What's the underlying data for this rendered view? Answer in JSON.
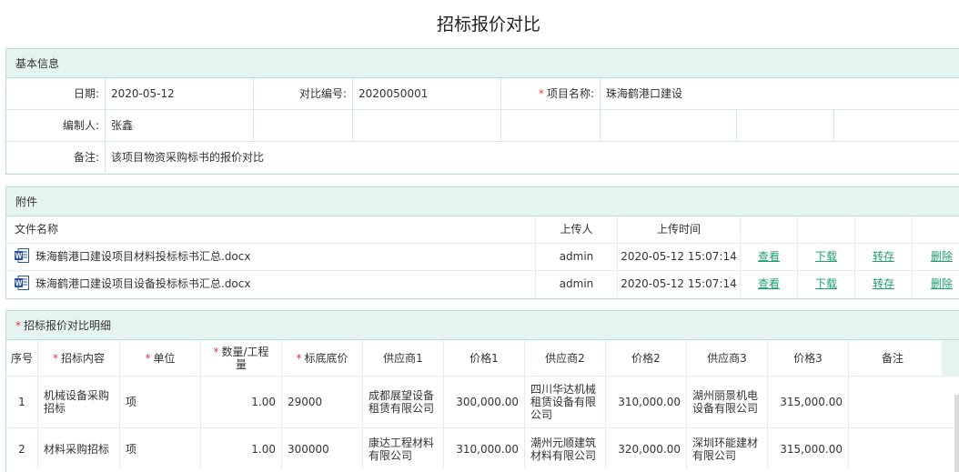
{
  "page": {
    "title": "招标报价对比"
  },
  "basic": {
    "header": "基本信息",
    "date_label": "日期:",
    "date_value": "2020-05-12",
    "no_label": "对比编号:",
    "no_value": "2020050001",
    "project_label": "项目名称:",
    "project_value": "珠海鹤港口建设",
    "editor_label": "编制人:",
    "editor_value": "张鑫",
    "remark_label": "备注:",
    "remark_value": "该项目物资采购标书的报价对比"
  },
  "attach": {
    "header": "附件",
    "columns": {
      "name": "文件名称",
      "uploader": "上传人",
      "time": "上传时间"
    },
    "actions": {
      "view": "查看",
      "download": "下载",
      "save": "转存",
      "delete": "删除"
    },
    "files": [
      {
        "name": "珠海鹤港口建设项目材料投标标书汇总.docx",
        "uploader": "admin",
        "time": "2020-05-12 15:07:14"
      },
      {
        "name": "珠海鹤港口建设项目设备投标标书汇总.docx",
        "uploader": "admin",
        "time": "2020-05-12 15:07:14"
      }
    ]
  },
  "compare": {
    "header": "招标报价对比明细",
    "columns": {
      "seq": "序号",
      "content": "招标内容",
      "unit": "单位",
      "qty": "数量/工程量",
      "base": "标底底价",
      "s1": "供应商1",
      "p1": "价格1",
      "s2": "供应商2",
      "p2": "价格2",
      "s3": "供应商3",
      "p3": "价格3",
      "remark": "备注"
    },
    "rows": [
      {
        "seq": "1",
        "content": "机械设备采购招标",
        "unit": "项",
        "qty": "1.00",
        "base": "29000",
        "s1": "成都展望设备租赁有限公司",
        "p1": "300,000.00",
        "s2": "四川华达机械租赁设备有限公司",
        "p2": "310,000.00",
        "s3": "湖州丽景机电设备有限公司",
        "p3": "315,000.00",
        "remark": ""
      },
      {
        "seq": "2",
        "content": "材料采购招标",
        "unit": "项",
        "qty": "1.00",
        "base": "300000",
        "s1": "康达工程材料有限公司",
        "p1": "310,000.00",
        "s2": "潮州元顺建筑材料有限公司",
        "p2": "320,000.00",
        "s3": "深圳环能建材有限公司",
        "p3": "315,000.00",
        "remark": ""
      }
    ]
  },
  "colors": {
    "header_bg": "#e6f4f1",
    "border": "#b9dcd6",
    "link": "#1e9e6e",
    "required": "#e8383d",
    "word_blue": "#2b579a"
  }
}
